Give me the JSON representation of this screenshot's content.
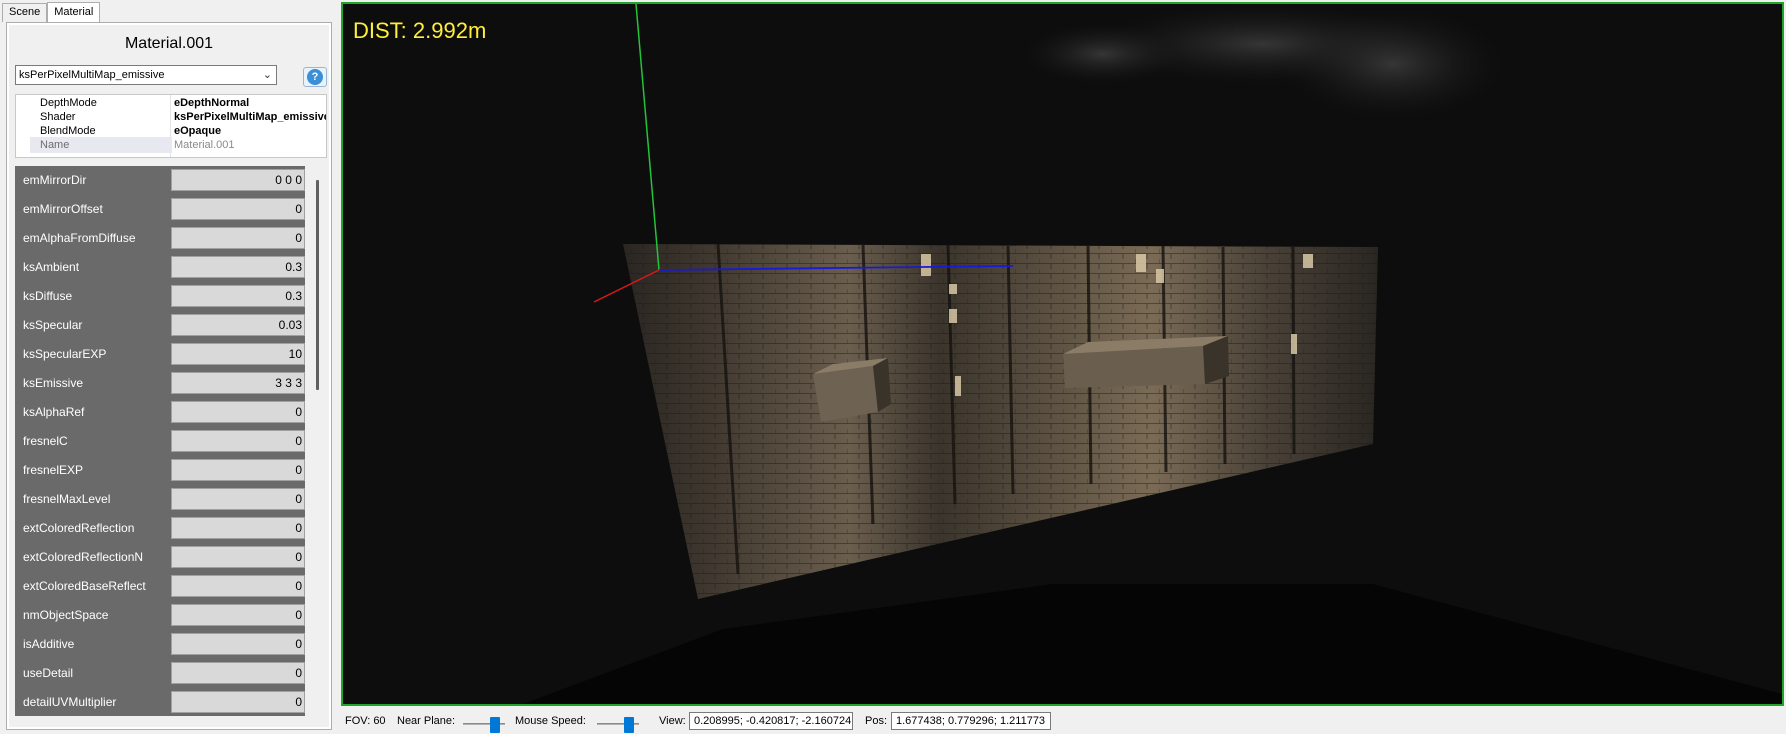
{
  "tabs": [
    {
      "label": "Scene"
    },
    {
      "label": "Material"
    }
  ],
  "material": {
    "title": "Material.001",
    "shader_select": "ksPerPixelMultiMap_emissive"
  },
  "properties": [
    {
      "name": "DepthMode",
      "value": "eDepthNormal"
    },
    {
      "name": "Shader",
      "value": "ksPerPixelMultiMap_emissive"
    },
    {
      "name": "BlendMode",
      "value": "eOpaque"
    },
    {
      "name": "Name",
      "value": "Material.001"
    }
  ],
  "params": [
    {
      "label": "emMirrorDir",
      "value": "0 0 0"
    },
    {
      "label": "emMirrorOffset",
      "value": "0"
    },
    {
      "label": "emAlphaFromDiffuse",
      "value": "0"
    },
    {
      "label": "ksAmbient",
      "value": "0.3"
    },
    {
      "label": "ksDiffuse",
      "value": "0.3"
    },
    {
      "label": "ksSpecular",
      "value": "0.03"
    },
    {
      "label": "ksSpecularEXP",
      "value": "10"
    },
    {
      "label": "ksEmissive",
      "value": "3 3 3"
    },
    {
      "label": "ksAlphaRef",
      "value": "0"
    },
    {
      "label": "fresnelC",
      "value": "0"
    },
    {
      "label": "fresnelEXP",
      "value": "0"
    },
    {
      "label": "fresnelMaxLevel",
      "value": "0"
    },
    {
      "label": "extColoredReflection",
      "value": "0"
    },
    {
      "label": "extColoredReflectionN",
      "value": "0"
    },
    {
      "label": "extColoredBaseReflect",
      "value": "0"
    },
    {
      "label": "nmObjectSpace",
      "value": "0"
    },
    {
      "label": "isAdditive",
      "value": "0"
    },
    {
      "label": "useDetail",
      "value": "0"
    },
    {
      "label": "detailUVMultiplier",
      "value": "0"
    }
  ],
  "viewport": {
    "dist": "DIST: 2.992m",
    "border_color": "#22a32a",
    "dist_color": "#ffef3a"
  },
  "status": {
    "fov": "FOV: 60",
    "near_plane_label": "Near Plane:",
    "near_plane_level": 0.85,
    "mouse_speed_label": "Mouse Speed:",
    "mouse_speed_level": 0.85,
    "view_label": "View:",
    "view_value": "0.208995; -0.420817; -2.160724",
    "pos_label": "Pos:",
    "pos_value": "1.677438; 0.779296; 1.211773"
  },
  "icons": {
    "help": "help-icon",
    "dropdown": "chevron-down-icon"
  }
}
